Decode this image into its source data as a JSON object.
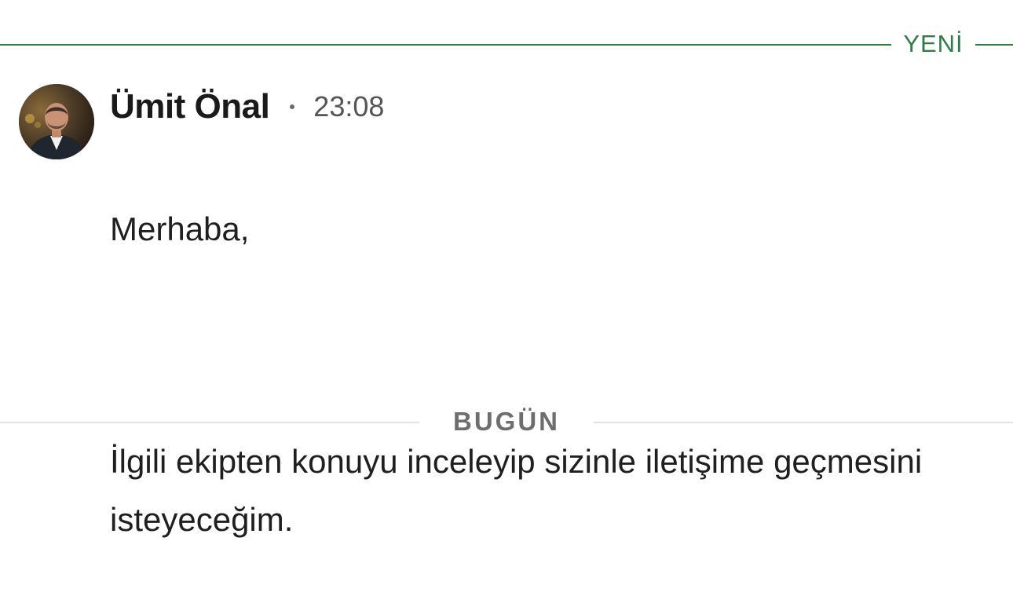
{
  "divider_new": {
    "label": "YENİ",
    "color": "#2f7d45"
  },
  "message": {
    "avatar_icon": "person-photo",
    "sender": "Ümit Önal",
    "time": "23:08",
    "paragraphs": [
      "Merhaba,",
      "İlgili ekipten konuyu inceleyip sizinle iletişime geçmesini isteyeceğim."
    ]
  },
  "divider_today": {
    "label": "BUGÜN"
  }
}
